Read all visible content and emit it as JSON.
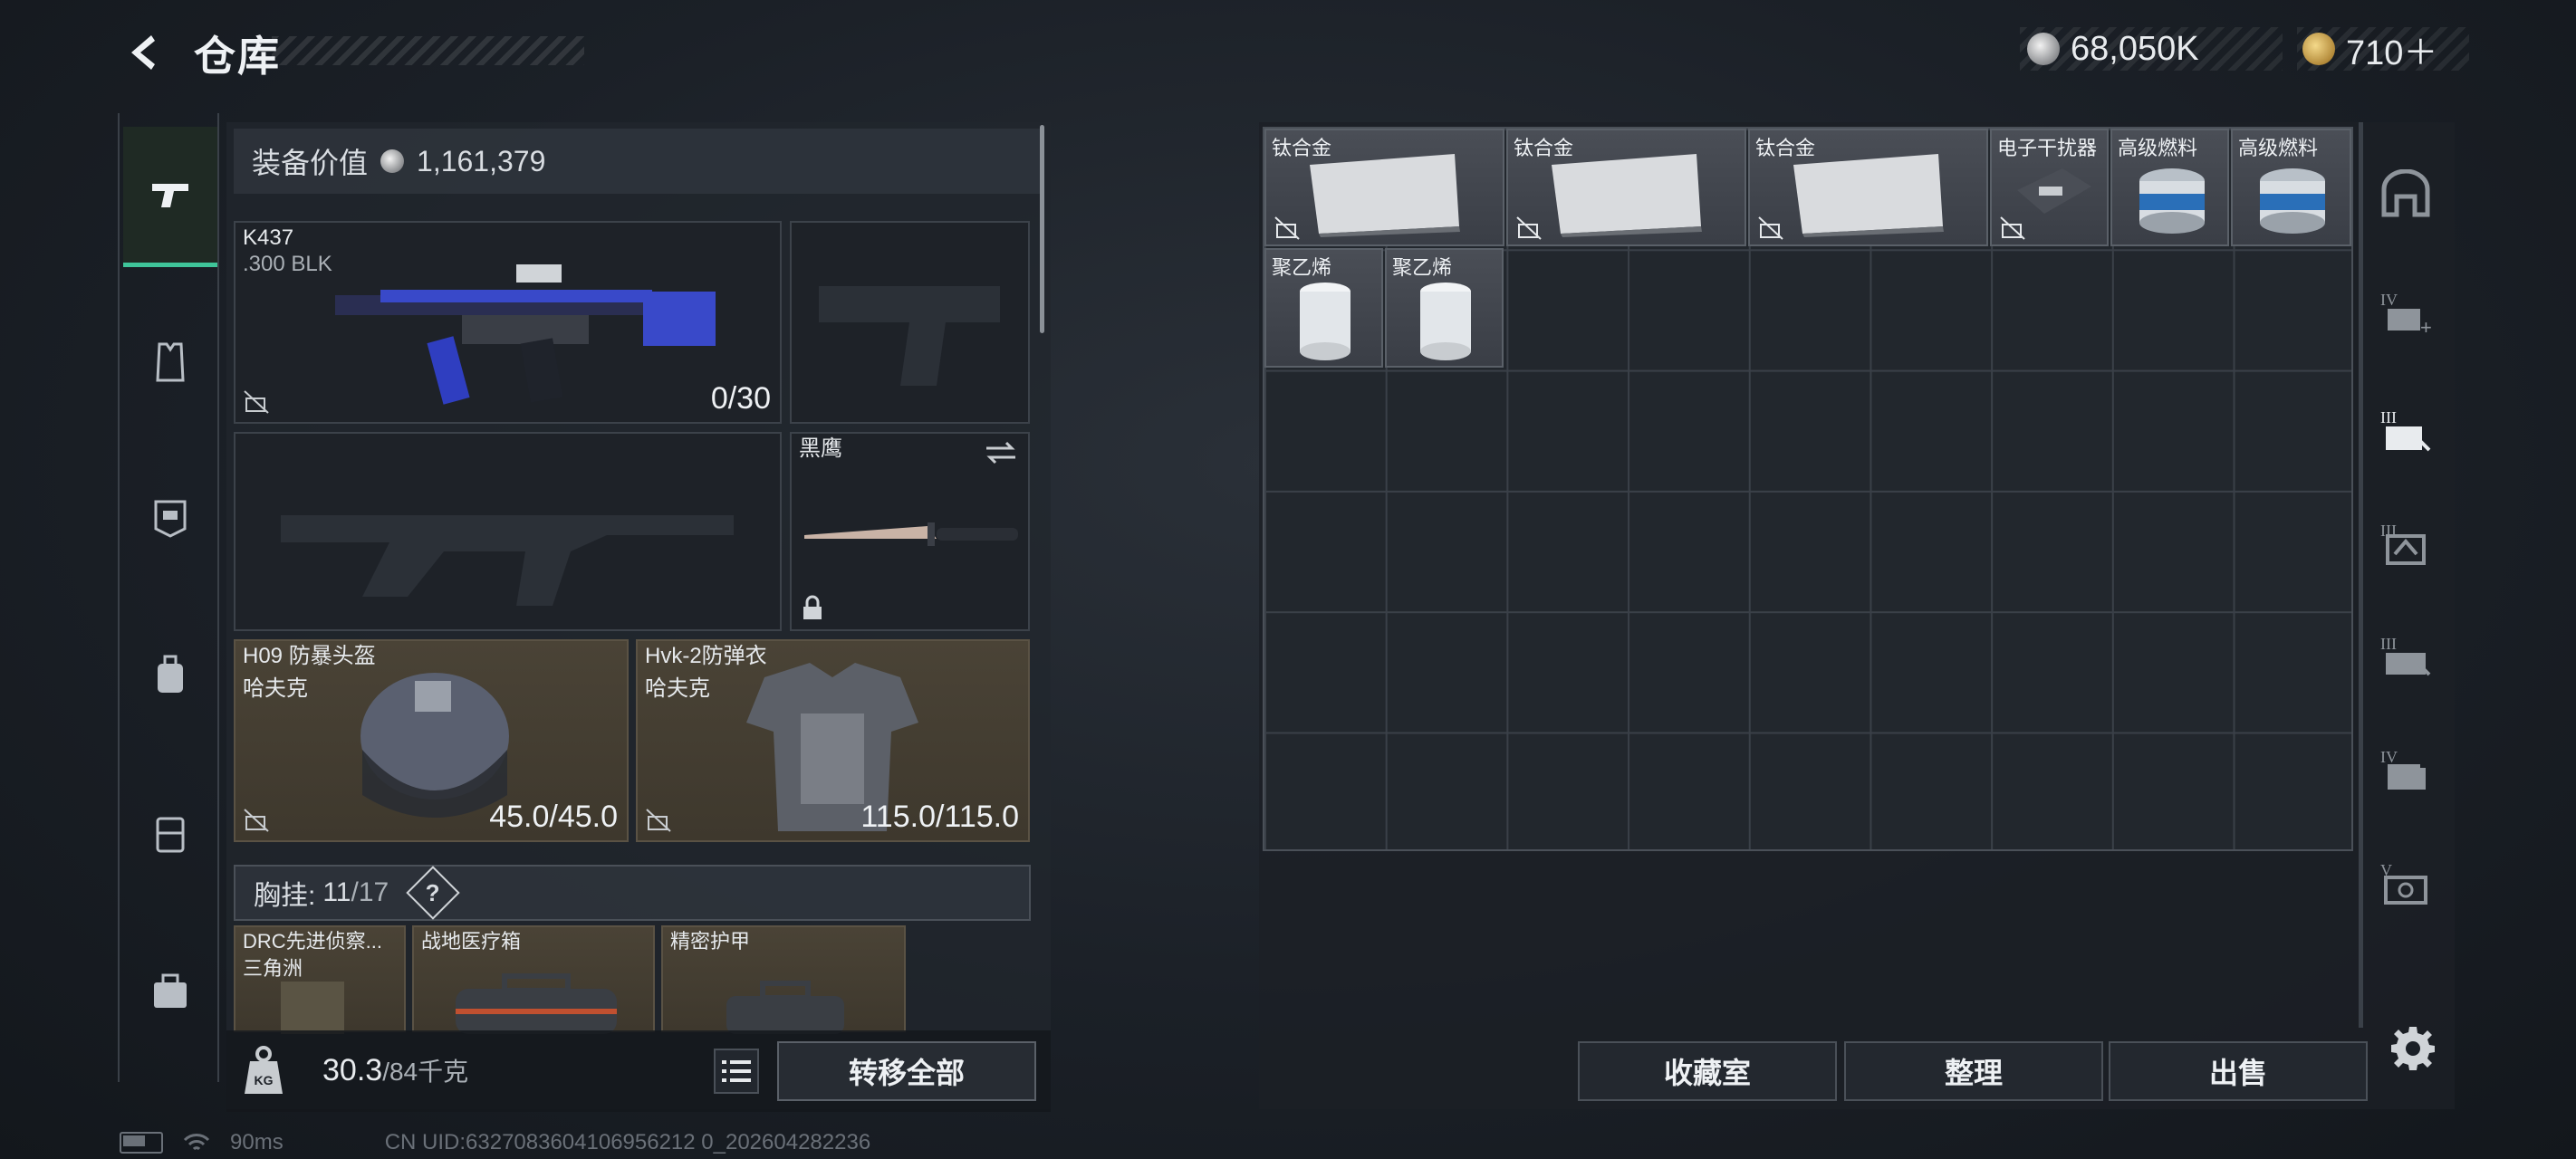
{
  "header": {
    "title": "仓库",
    "currency_silver": "68,050K",
    "currency_gold": "710＋"
  },
  "equipment": {
    "value_label": "装备价值",
    "value": "1,161,379",
    "primary_weapon": {
      "name": "K437",
      "caliber": ".300 BLK",
      "ammo": "0/30"
    },
    "melee": {
      "name": "黑鹰"
    },
    "helmet": {
      "name": "H09 防暴头盔",
      "brand": "哈夫克",
      "durability": "45.0/45.0"
    },
    "armor": {
      "name": "Hvk-2防弹衣",
      "brand": "哈夫克",
      "durability": "115.0/115.0"
    },
    "chest_rig": {
      "label": "胸挂:",
      "used": "11",
      "capacity": "/17",
      "help": "?"
    },
    "rig_items": [
      {
        "name": "DRC先进侦察...",
        "sub": "三角洲"
      },
      {
        "name": "战地医疗箱",
        "sub": ""
      },
      {
        "name": "精密护甲",
        "sub": ""
      }
    ],
    "weight": {
      "current": "30.3",
      "max": "/84千克"
    },
    "transfer_all": "转移全部"
  },
  "storage": {
    "items": [
      {
        "label": "钛合金"
      },
      {
        "label": "钛合金"
      },
      {
        "label": "钛合金"
      },
      {
        "label": "电子干扰器"
      },
      {
        "label": "高级燃料"
      },
      {
        "label": "高级燃料"
      },
      {
        "label": "聚乙烯"
      },
      {
        "label": "聚乙烯"
      }
    ],
    "buttons": {
      "collection": "收藏室",
      "organize": "整理",
      "sell": "出售"
    },
    "right_rail": [
      {
        "icon": "warehouse-icon"
      },
      {
        "icon": "tier4-expand-icon",
        "tier": "IV"
      },
      {
        "icon": "tier3-case-icon",
        "tier": "III"
      },
      {
        "icon": "tier3-box-icon",
        "tier": "III"
      },
      {
        "icon": "tier3-shelf-icon",
        "tier": "III"
      },
      {
        "icon": "tier4-box-icon",
        "tier": "IV"
      },
      {
        "icon": "tier5-safe-icon",
        "tier": "V"
      }
    ]
  },
  "status": {
    "ping": "90ms",
    "uid": "CN UID:6327083604106956212 0_202604282236"
  },
  "colors": {
    "accent_green": "#3fc59a",
    "panel": "#22272d"
  }
}
